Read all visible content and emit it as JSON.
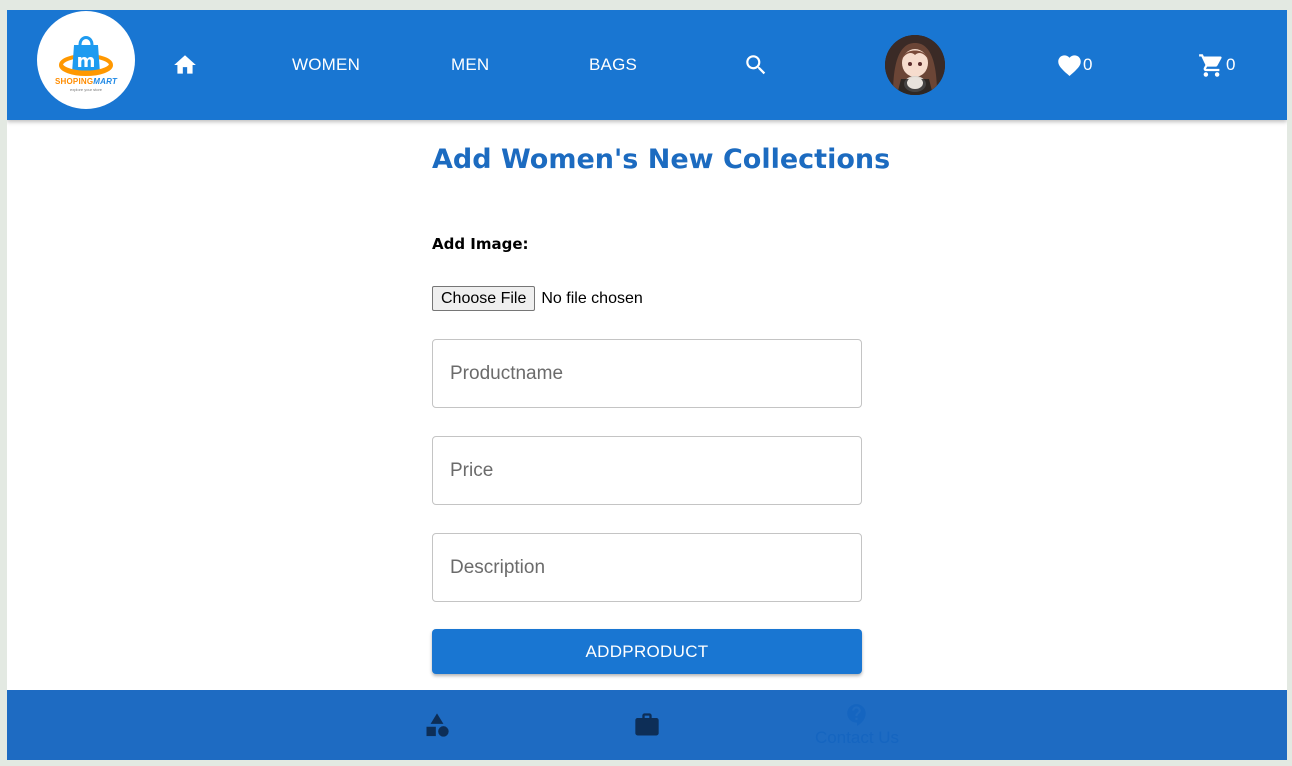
{
  "header": {
    "logo": {
      "brand_part1": "SHOPING",
      "brand_part2": "MART",
      "tagline": "explore your store"
    },
    "nav": {
      "home_icon": "home-icon",
      "women": "WOMEN",
      "men": "MEN",
      "bags": "BAGS",
      "search_icon": "search-icon"
    },
    "avatar_icon": "avatar",
    "wishlist": {
      "icon": "heart-icon",
      "count": "0"
    },
    "cart": {
      "icon": "cart-icon",
      "count": "0"
    }
  },
  "form": {
    "title": "Add Women's New Collections",
    "image_label": "Add Image:",
    "file_button": "Choose File",
    "file_status": "No file chosen",
    "productname_placeholder": "Productname",
    "price_placeholder": "Price",
    "description_placeholder": "Description",
    "submit_label": "ADDPRODUCT"
  },
  "bottom_nav": {
    "items": [
      {
        "icon": "category-icon",
        "label": ""
      },
      {
        "icon": "briefcase-icon",
        "label": ""
      },
      {
        "icon": "help-icon",
        "label": "Contact Us"
      }
    ]
  },
  "colors": {
    "primary": "#1976d2",
    "title": "#1c6bc0",
    "bottom_bar": "#1e6bc2",
    "page_bg": "#e3e9e2"
  }
}
